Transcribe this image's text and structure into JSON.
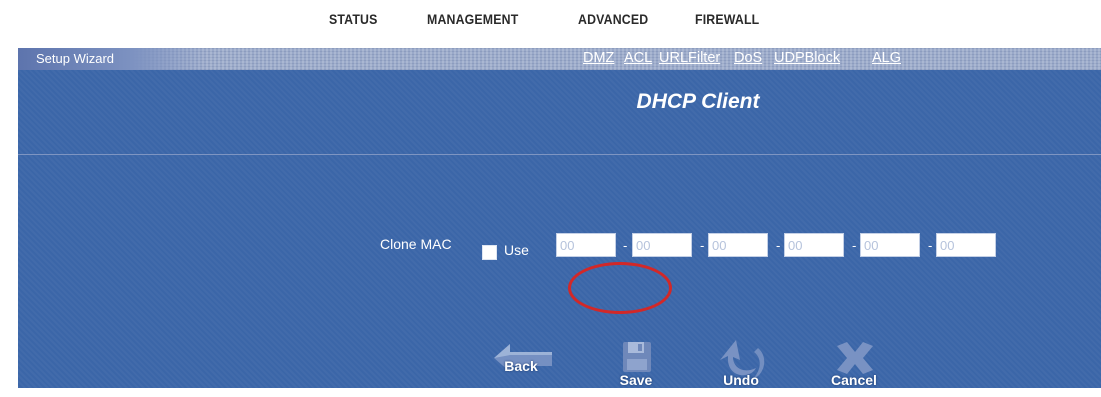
{
  "top_nav": {
    "items": [
      "STATUS",
      "MANAGEMENT",
      "ADVANCED",
      "FIREWALL"
    ]
  },
  "sub_nav": {
    "wizard_label": "Setup Wizard",
    "links": [
      "DMZ",
      "ACL",
      "URLFilter",
      "DoS",
      "UDPBlock",
      "ALG"
    ]
  },
  "page": {
    "title": "DHCP Client"
  },
  "clone_mac": {
    "label": "Clone MAC",
    "use_label": "Use",
    "use_checked": false,
    "separator": "-",
    "octets": [
      "00",
      "00",
      "00",
      "00",
      "00",
      "00"
    ]
  },
  "actions": {
    "back": "Back",
    "save": "Save",
    "undo": "Undo",
    "cancel": "Cancel"
  },
  "colors": {
    "panel": "#3b66a8",
    "highlight_ring": "#d22828"
  }
}
